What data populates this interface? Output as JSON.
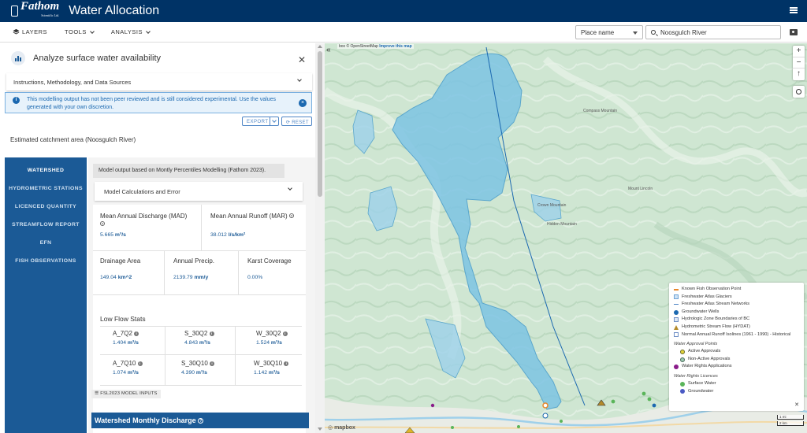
{
  "header": {
    "logo_text": "Fathom",
    "logo_sub": "Scientific Ltd.",
    "title": "Water Allocation"
  },
  "toolbar": {
    "layers": "LAYERS",
    "tools": "TOOLS",
    "analysis": "ANALYSIS",
    "place_select": "Place name",
    "search_value": "Noosgulch River"
  },
  "panel": {
    "title": "Analyze surface water availability",
    "instructions": "Instructions, Methodology, and Data Sources",
    "notice_line1": "This modelling output has not been peer reviewed and is still considered experimental. Use the values",
    "notice_line2": "generated with your own discretion.",
    "export": "EXPORT",
    "reset": "RESET",
    "catchment": "Estimated catchment area (Noosgulch River)"
  },
  "nav": {
    "items": [
      {
        "label": "WATERSHED"
      },
      {
        "label": "HYDROMETRIC STATIONS"
      },
      {
        "label": "LICENCED QUANTITY"
      },
      {
        "label": "STREAMFLOW REPORT"
      },
      {
        "label": "EFN"
      },
      {
        "label": "FISH OBSERVATIONS"
      }
    ]
  },
  "content": {
    "model_note": "Model output based on Montly Percentiles Modelling (Fathom 2023).",
    "calc_label": "Model Calculations and Error",
    "mad_label": "Mean Annual Discharge (MAD)",
    "mad_value": "5.665",
    "mad_unit": "m³/s",
    "mar_label": "Mean Annual Runoff (MAR)",
    "mar_value": "38.012",
    "mar_unit": "l/s/km²",
    "drainage_label": "Drainage Area",
    "drainage_value": "149.04",
    "drainage_unit": "km^2",
    "precip_label": "Annual Precip.",
    "precip_value": "2139.79",
    "precip_unit": "mm/y",
    "karst_label": "Karst Coverage",
    "karst_value": "0.00%",
    "low_flow_title": "Low Flow Stats",
    "low_flow": [
      {
        "label": "A_7Q2",
        "value": "1.404",
        "unit": "m³/s"
      },
      {
        "label": "S_30Q2",
        "value": "4.843",
        "unit": "m³/s"
      },
      {
        "label": "W_30Q2",
        "value": "1.524",
        "unit": "m³/s"
      },
      {
        "label": "A_7Q10",
        "value": "1.074",
        "unit": "m³/s"
      },
      {
        "label": "S_30Q10",
        "value": "4.390",
        "unit": "m³/s"
      },
      {
        "label": "W_30Q10",
        "value": "1.142",
        "unit": "m³/s"
      }
    ],
    "fsl_button": "FSL2023 MODEL INPUTS",
    "monthly_title": "Watershed Monthly Discharge"
  },
  "map": {
    "attribution_prefix": "box © OpenStreetMap",
    "improve": "Improve this map",
    "zoom_in": "+",
    "zoom_out": "−",
    "north": "↑",
    "scale_1": "1 mi",
    "scale_2": "2 km",
    "mapbox": "mapbox",
    "place_labels": [
      "Compass Mountain",
      "Mount Lincoln",
      "Crown Mountain",
      "Hidden Mountain"
    ],
    "legend": {
      "items": [
        "Known Fish Observation Point",
        "Freshwater Atlas Glaciers",
        "Freshwater Atlas Stream Networks",
        "Groundwater Wells",
        "Hydrologic Zone Boundaries of BC",
        "Hydrometric Stream Flow (HYDAT)",
        "Normal Annual Runoff Isolines (1961 - 1990) - Historical"
      ],
      "approval_title": "Water Approval Points",
      "approvals": [
        "Active Approvals",
        "Non-Active Approvals",
        "Water Rights Applications"
      ],
      "licence_title": "Water Rights Licences",
      "licences": [
        "Surface Water",
        "Groundwater"
      ]
    }
  },
  "colors": {
    "header": "#003366",
    "accent": "#1b5a96",
    "watershed": "#7cc3e3",
    "map_terrain": "#cfe6d2"
  }
}
